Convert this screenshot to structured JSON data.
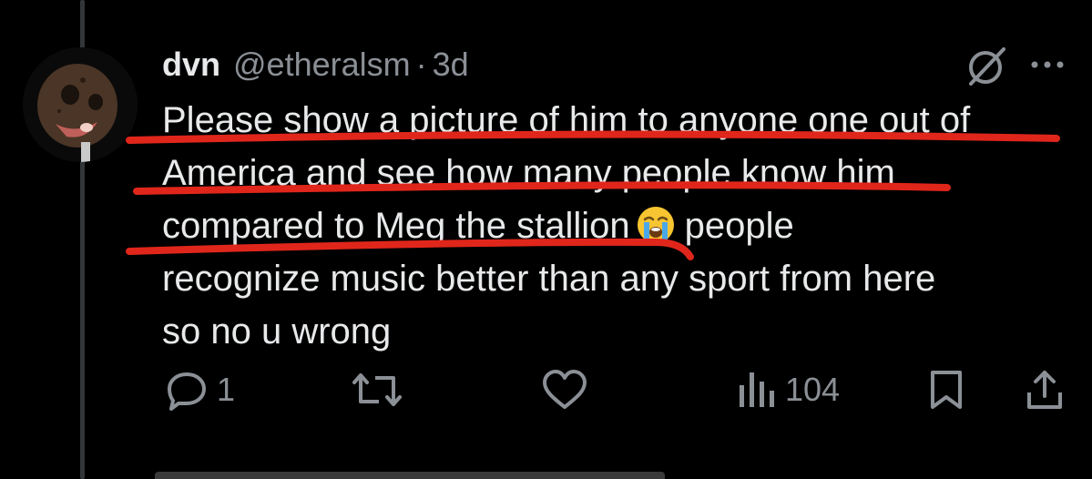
{
  "tweet": {
    "author_name": "dvn",
    "author_handle": "@etheralsm",
    "separator": "·",
    "timestamp": "3d",
    "text_lines": [
      "Please show a picture of him to anyone one out of",
      "America and see how many people know him",
      "compared to Meg the stallion",
      "people",
      "recognize music better than any sport from here",
      "so no u wrong"
    ],
    "emoji_name": "loudly-crying-face-emoji"
  },
  "actions": {
    "reply_count": "1",
    "views_count": "104"
  },
  "colors": {
    "background": "#000000",
    "text": "#e7e9ea",
    "muted": "#8b9096",
    "annotation": "#e0261b"
  }
}
